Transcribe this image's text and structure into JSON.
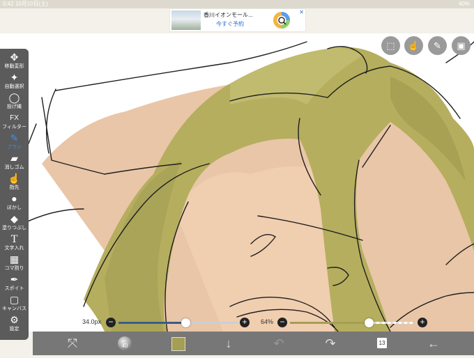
{
  "status_bar": {
    "time": "0:42",
    "date": "10月10日(土)",
    "right": "40%"
  },
  "ad": {
    "title": "香川イオンモール...",
    "cta": "今すぐ予約",
    "close": "✕"
  },
  "toolbar": {
    "items": [
      {
        "label": "移動変形",
        "icon": "move-icon",
        "glyph": "✥",
        "active": false
      },
      {
        "label": "自動選択",
        "icon": "magic-wand-icon",
        "glyph": "✦",
        "active": false
      },
      {
        "label": "投げ縄",
        "icon": "lasso-icon",
        "glyph": "◯",
        "active": false
      },
      {
        "label": "フィルター",
        "icon": "filter-icon",
        "glyph": "FX",
        "active": false
      },
      {
        "label": "ブラシ",
        "icon": "brush-icon",
        "glyph": "✎",
        "active": true
      },
      {
        "label": "消しゴム",
        "icon": "eraser-icon",
        "glyph": "▰",
        "active": false
      },
      {
        "label": "指先",
        "icon": "finger-icon",
        "glyph": "☝",
        "active": false
      },
      {
        "label": "ぼかし",
        "icon": "blur-icon",
        "glyph": "●",
        "active": false
      },
      {
        "label": "塗りつぶし",
        "icon": "fill-icon",
        "glyph": "◆",
        "active": false
      },
      {
        "label": "文字入れ",
        "icon": "text-icon",
        "glyph": "T",
        "active": false
      },
      {
        "label": "コマ割り",
        "icon": "frame-divide-icon",
        "glyph": "▦",
        "active": false
      },
      {
        "label": "スポイト",
        "icon": "eyedropper-icon",
        "glyph": "✒",
        "active": false
      },
      {
        "label": "キャンバス",
        "icon": "canvas-icon",
        "glyph": "▢",
        "active": false
      },
      {
        "label": "設定",
        "icon": "gear-icon",
        "glyph": "⚙",
        "active": false
      }
    ]
  },
  "top_icons": [
    {
      "icon": "selection-icon",
      "glyph": "⬚"
    },
    {
      "icon": "hand-icon",
      "glyph": "☝"
    },
    {
      "icon": "pen-icon",
      "glyph": "✎"
    },
    {
      "icon": "image-icon",
      "glyph": "▣"
    }
  ],
  "brush_size": {
    "label": "34.0px",
    "level": 0.56
  },
  "opacity": {
    "label": "64%",
    "level": 0.64
  },
  "bottom": {
    "brush_badge": "40",
    "layer_count": "13"
  },
  "colors": {
    "hair": "#b5ae5e",
    "skin": "#e9c6a8",
    "toolbar_bg": "#5b5b5b",
    "active": "#3d8ef0",
    "slider_track": "#3a5c8a",
    "current_color": "#a59e55"
  }
}
